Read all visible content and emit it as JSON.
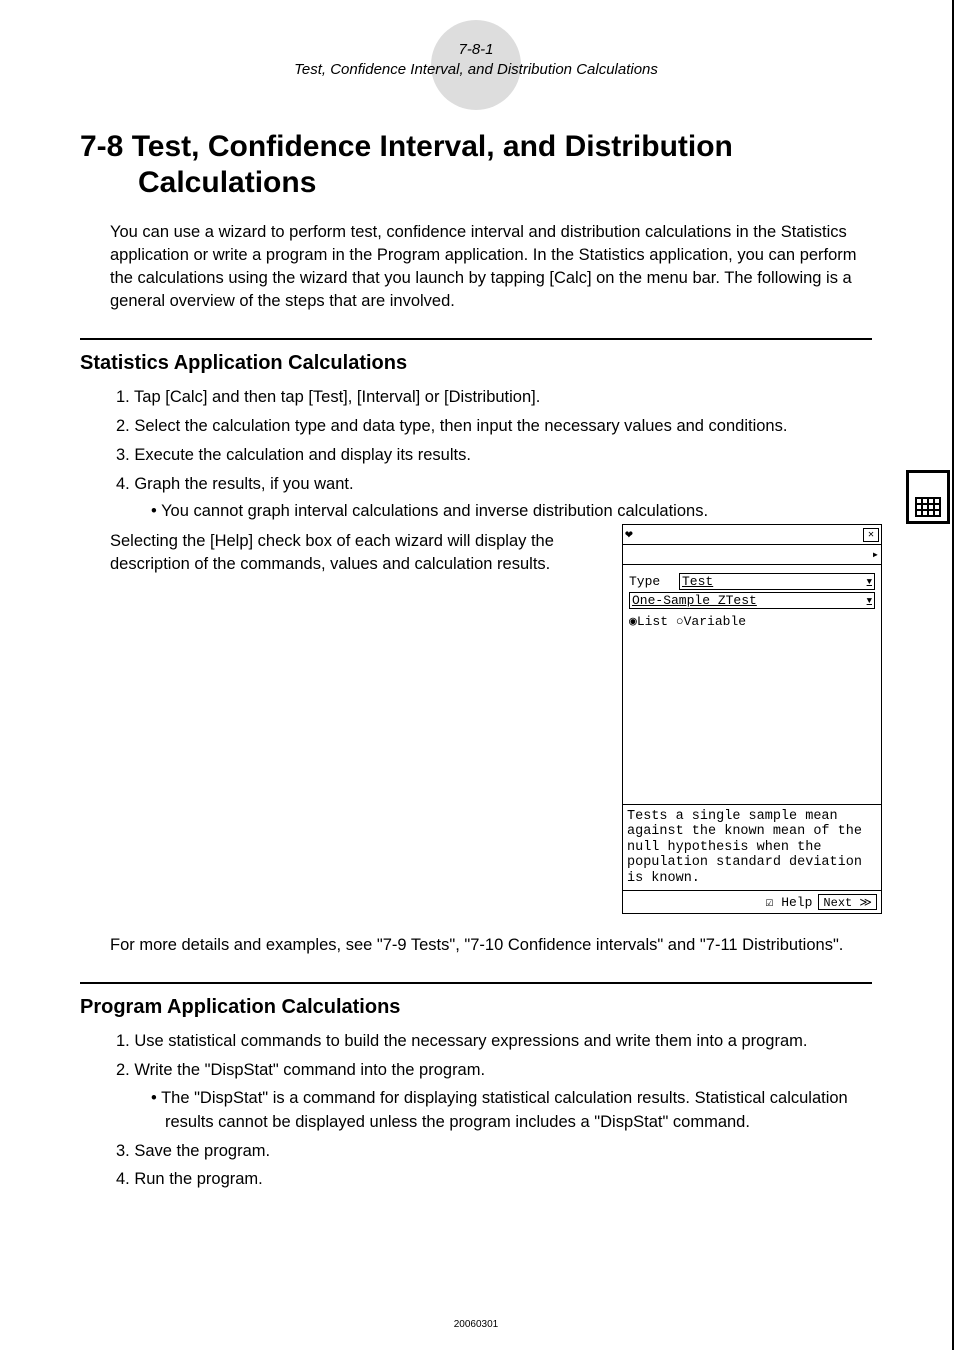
{
  "header": {
    "page_ref": "7-8-1",
    "subtitle": "Test, Confidence Interval, and Distribution Calculations"
  },
  "title": {
    "prefix": "7-8",
    "main": "Test, Confidence Interval, and Distribution Calculations"
  },
  "intro": "You can use a wizard to perform test, confidence interval and distribution calculations in the Statistics application or write a program in the Program application. In the Statistics application, you can perform the calculations using the wizard that you launch by tapping [Calc] on the menu bar. The following is a general overview of the steps that are involved.",
  "section1": {
    "heading": "Statistics Application Calculations",
    "steps": [
      "1. Tap [Calc] and then tap [Test], [Interval] or [Distribution].",
      "2. Select the calculation type and data type, then input the necessary values and conditions.",
      "3. Execute the calculation and display its results.",
      "4. Graph the results, if you want."
    ],
    "bullet": "• You cannot graph interval calculations and inverse distribution calculations.",
    "help_text": "Selecting the [Help] check box of each wizard will display the description of the commands, values and calculation results.",
    "more_details": "For more details and examples, see \"7-9 Tests\", \"7-10 Confidence intervals\" and \"7-11 Distributions\"."
  },
  "wizard": {
    "type_label": "Type",
    "type_value": "Test",
    "subtype_value": "One-Sample ZTest",
    "radio_list": "◉List ○Variable",
    "help_desc": "Tests a single sample mean against the known mean of the null hypothesis when the population standard deviation is known.",
    "help_check": "☑ Help",
    "next_btn": "Next ≫"
  },
  "section2": {
    "heading": "Program Application Calculations",
    "steps": [
      "1. Use statistical commands to build the necessary expressions and write them into a program.",
      "2. Write the \"DispStat\" command into the program."
    ],
    "bullet": "• The \"DispStat\" is a command for displaying statistical calculation results. Statistical calculation results cannot be displayed unless the program includes a \"DispStat\" command.",
    "steps_after": [
      "3. Save the program.",
      "4. Run the program."
    ]
  },
  "footer": "20060301"
}
